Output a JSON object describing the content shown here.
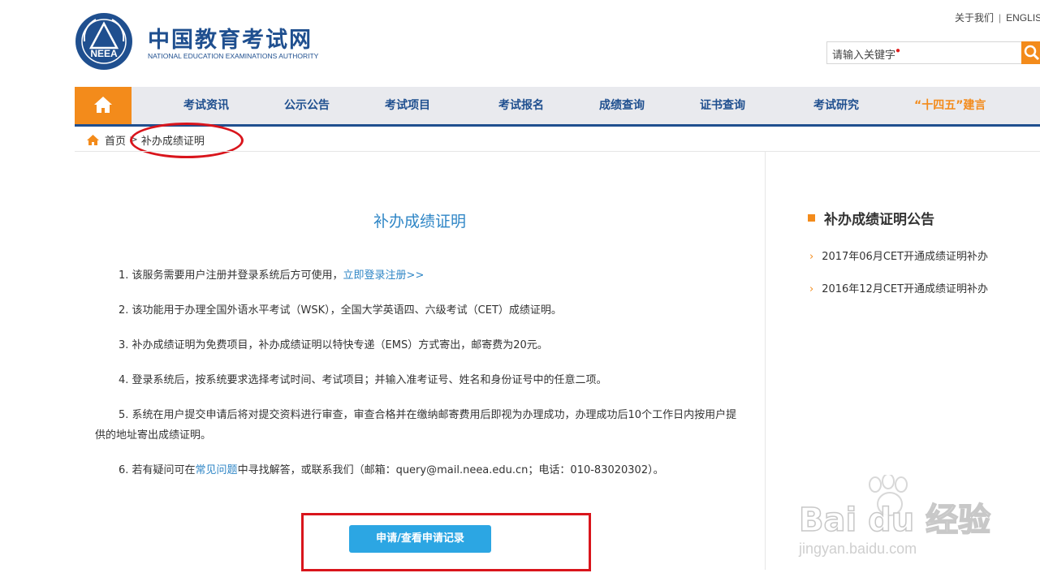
{
  "header": {
    "logo_cn": "中国教育考试网",
    "logo_en": "NATIONAL EDUCATION EXAMINATIONS AUTHORITY",
    "logo_emblem_text": "NEEA",
    "top_links": [
      "关于我们",
      "ENGLISH"
    ],
    "search_placeholder": "请输入关键字"
  },
  "nav": {
    "items": [
      "考试资讯",
      "公示公告",
      "考试项目",
      "考试报名",
      "成绩查询",
      "证书查询",
      "考试研究",
      "“十四五”建言"
    ]
  },
  "breadcrumb": {
    "home": "首页",
    "separator": ">",
    "current": "补办成绩证明"
  },
  "main": {
    "title": "补办成绩证明",
    "items": {
      "p1_text": "1. 该服务需要用户注册并登录系统后方可使用，",
      "p1_link": "立即登录注册>>",
      "p2": "2. 该功能用于办理全国外语水平考试（WSK），全国大学英语四、六级考试（CET）成绩证明。",
      "p3": "3. 补办成绩证明为免费项目，补办成绩证明以特快专递（EMS）方式寄出，邮寄费为20元。",
      "p4": "4. 登录系统后，按系统要求选择考试时间、考试项目；并输入准考证号、姓名和身份证号中的任意二项。",
      "p5": "5. 系统在用户提交申请后将对提交资料进行审查，审查合格并在缴纳邮寄费用后即视为办理成功，办理成功后10个工作日内按用户提供的地址寄出成绩证明。",
      "p6_prefix": "6. 若有疑问可在",
      "p6_link": "常见问题",
      "p6_suffix": "中寻找解答，或联系我们（邮箱：query@mail.neea.edu.cn；电话：010-83020302）。"
    },
    "apply_button": "申请/查看申请记录"
  },
  "sidebar": {
    "title": "补办成绩证明公告",
    "items": [
      "2017年06月CET开通成绩证明补办",
      "2016年12月CET开通成绩证明补办"
    ]
  },
  "watermark": {
    "brand": "Bai du 经验",
    "url": "jingyan.baidu.com"
  },
  "colors": {
    "brand_blue": "#1f4f8f",
    "accent_orange": "#f38b1b",
    "link_blue": "#2f86c6",
    "button_blue": "#2ca6e3",
    "annotation_red": "#d9151c"
  }
}
